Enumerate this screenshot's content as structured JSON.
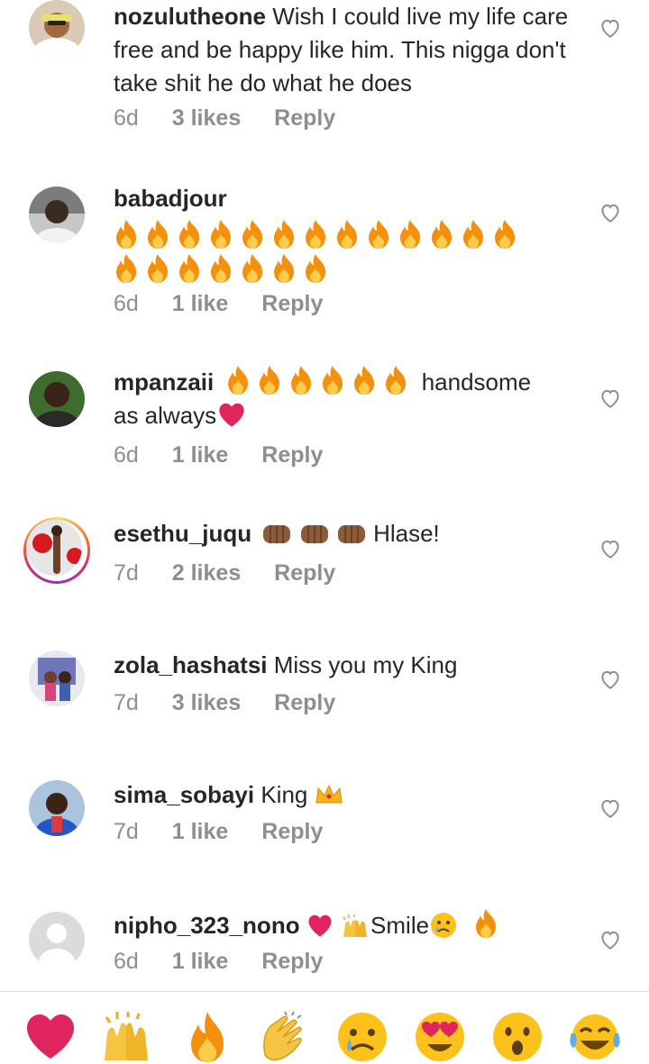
{
  "comments": [
    {
      "username": "nozulutheone",
      "text": "Wish I could live my life care free and be happy like him. This nigga don't take shit he do what he does",
      "time": "6d",
      "likes": "3 likes",
      "reply": "Reply"
    },
    {
      "username": "babadjour",
      "text": "",
      "fire_count": 20,
      "time": "6d",
      "likes": "1 like",
      "reply": "Reply"
    },
    {
      "username": "mpanzaii",
      "text_after": "handsome",
      "text_line2": "as always",
      "fire_count": 6,
      "time": "6d",
      "likes": "1 like",
      "reply": "Reply"
    },
    {
      "username": "esethu_juqu",
      "text": "Hlase!",
      "time": "7d",
      "likes": "2 likes",
      "reply": "Reply"
    },
    {
      "username": "zola_hashatsi",
      "text": "Miss you my King",
      "time": "7d",
      "likes": "3 likes",
      "reply": "Reply"
    },
    {
      "username": "sima_sobayi",
      "text": "King",
      "time": "7d",
      "likes": "1 like",
      "reply": "Reply"
    },
    {
      "username": "nipho_323_nono",
      "text": "Smile",
      "time": "6d",
      "likes": "1 like",
      "reply": "Reply"
    }
  ],
  "reactions": [
    "heart",
    "raised-hands",
    "fire",
    "clapping-hands",
    "sad-face",
    "heart-eyes",
    "surprised-face",
    "tears-of-joy"
  ],
  "colors": {
    "text": "#262626",
    "meta": "#8e8e8e",
    "heart": "#e0245e",
    "fire": "#f4900c"
  }
}
